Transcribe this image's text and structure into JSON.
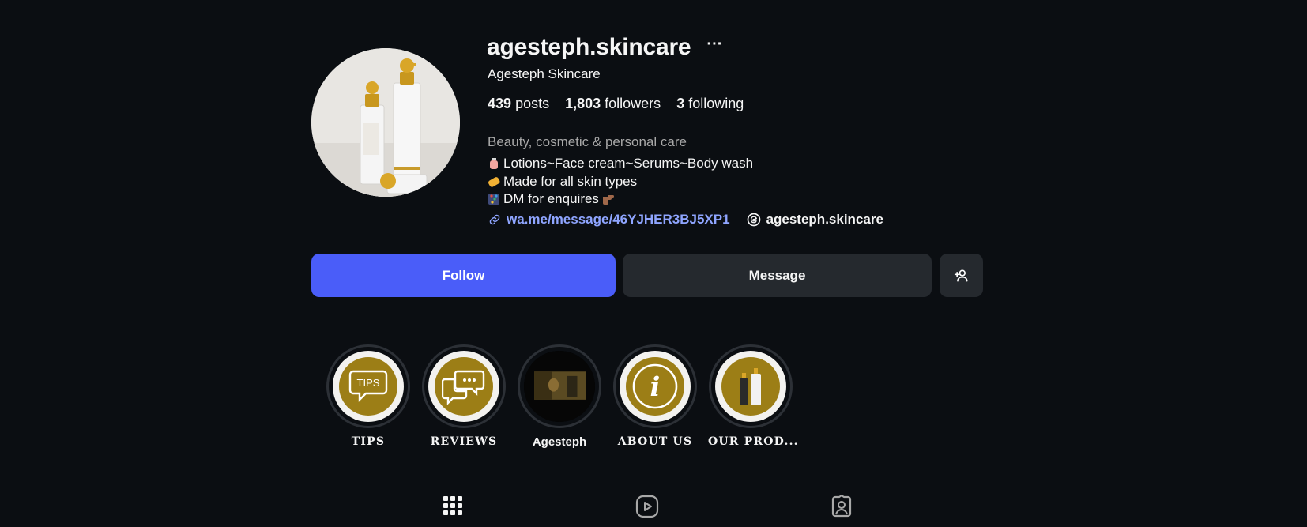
{
  "profile": {
    "username": "agesteph.skincare",
    "more_label": "···",
    "full_name": "Agesteph Skincare",
    "stats": {
      "posts_count": "439",
      "posts_label": "posts",
      "followers_count": "1,803",
      "followers_label": "followers",
      "following_count": "3",
      "following_label": "following"
    },
    "category": "Beauty, cosmetic & personal care",
    "bio": [
      {
        "emoji": "lotion-bottle",
        "text": "Lotions~Face cream~Serums~Body wash"
      },
      {
        "emoji": "soap",
        "text": "Made for all skin types"
      },
      {
        "emoji": "abacus",
        "text": "DM for enquires",
        "trailing_emoji": "pointing-hand"
      }
    ],
    "link": "wa.me/message/46YJHER3BJ5XP1",
    "threads_handle": "agesteph.skincare"
  },
  "actions": {
    "follow": "Follow",
    "message": "Message"
  },
  "highlights": [
    {
      "label": "TIPS",
      "icon": "tips-speech-bubble",
      "badge": "TIPS"
    },
    {
      "label": "REVIEWS",
      "icon": "reviews-chat-icon"
    },
    {
      "label": "Agesteph",
      "icon": "video-thumbnail"
    },
    {
      "label": "ABOUT US",
      "icon": "info-icon",
      "glyph": "i"
    },
    {
      "label": "OUR PROD...",
      "icon": "product-bottles"
    }
  ],
  "colors": {
    "background": "#0b0e12",
    "follow_button": "#4a5df9",
    "secondary_button": "#25292e",
    "link": "#8fa5ff",
    "highlight_gold": "#9c7e16"
  },
  "tabs": [
    {
      "name": "posts",
      "icon": "grid-icon",
      "active": true
    },
    {
      "name": "reels",
      "icon": "reels-icon",
      "active": false
    },
    {
      "name": "tagged",
      "icon": "tagged-icon",
      "active": false
    }
  ]
}
